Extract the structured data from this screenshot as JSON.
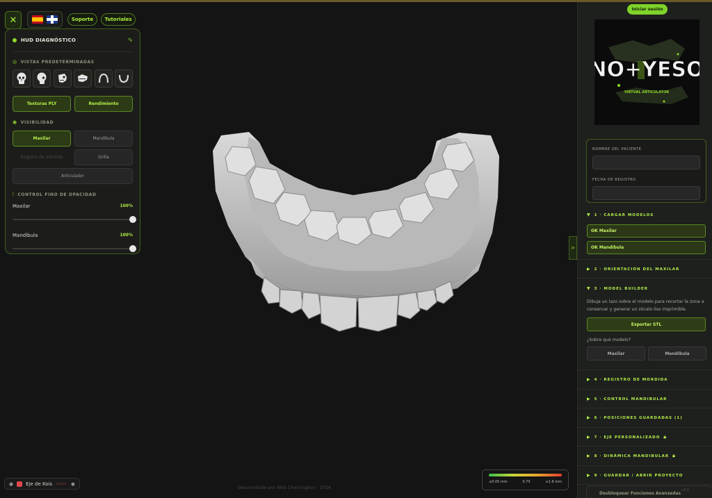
{
  "toolbar": {
    "close_icon": "close-icon",
    "languages": [
      "es",
      "en"
    ],
    "support_label": "Soporte",
    "tutorials_label": "Tutoriales"
  },
  "hud": {
    "title": "HUD DIAGNÓSTICO",
    "views_label": "VISTAS PREDETERMINADAS",
    "views": [
      "skull-front-icon",
      "skull-side-icon",
      "skull-jaw-icon",
      "mandible-side-icon",
      "arch-upper-icon",
      "arch-lower-icon"
    ],
    "ply_label": "Texturas PLY",
    "performance_label": "Rendimiento",
    "visibility_label": "VISIBILIDAD",
    "maxilar_label": "Maxilar",
    "mandibula_label": "Mandíbula",
    "bite_label": "Registro de mordida",
    "grid_label": "Grilla",
    "articulator_label": "Articulador",
    "opacity_label": "CONTROL FINO DE OPACIDAD",
    "maxilar_opacity_label": "Maxilar",
    "maxilar_opacity_value": "100%",
    "maxilar_opacity": 1.0,
    "mandibula_opacity_label": "Mandíbula",
    "mandibula_opacity_value": "100%",
    "mandibula_opacity": 1.0
  },
  "viewport": {
    "axis_name": "Eje de Kois",
    "axis_status": "activo",
    "credit": "Desarrollado por Milo Cherrington · 2026",
    "legend": {
      "min": "≤0.05 mm",
      "mid": "0.75",
      "max": "≥1.6 mm"
    }
  },
  "panel": {
    "login_label": "Iniciar sesión",
    "logo_main": "NO+YESO",
    "logo_sub": "VIRTUAL ARTICULATOR",
    "patient_label": "NOMBRE DEL PACIENTE",
    "date_label": "FECHA DE REGISTRO",
    "sections": [
      {
        "label": "1 · CARGAR MODELOS",
        "open": true
      },
      {
        "label": "2 · ORIENTACIÓN DEL MAXILAR",
        "open": false
      },
      {
        "label": "3 · MODEL BUILDER",
        "open": true
      },
      {
        "label": "4 · REGISTRO DE MORDIDA",
        "open": false
      },
      {
        "label": "5 · CONTROL MANDIBULAR",
        "open": false
      },
      {
        "label": "6 · POSICIONES GUARDADAS (1)",
        "open": false
      },
      {
        "label": "7 · EJE PERSONALIZADO",
        "open": false,
        "locked": true
      },
      {
        "label": "8 · DINÁMICA MANDIBULAR",
        "open": false,
        "locked": true
      },
      {
        "label": "9 · GUARDAR / ABRIR PROYECTO",
        "open": false
      }
    ],
    "ok_maxilar": "OK Maxilar",
    "ok_mandibula": "OK Mandíbula",
    "builder_text": "Dibuja un lazo sobre el modelo para recortar la zona a conservar y generar un zócalo liso imprimible.",
    "export_label": "Exportar STL",
    "which_model": "¿Sobre qué modelo?",
    "opt_maxilar": "Maxilar",
    "opt_mandibula": "Mandíbula",
    "unlock_label": "Desbloquear Funciones Avanzadas",
    "version": "v2.0"
  },
  "colors": {
    "accent": "#8fdc2a",
    "panel": "#1e201d",
    "background": "#141414",
    "axis": "#e0484c"
  }
}
